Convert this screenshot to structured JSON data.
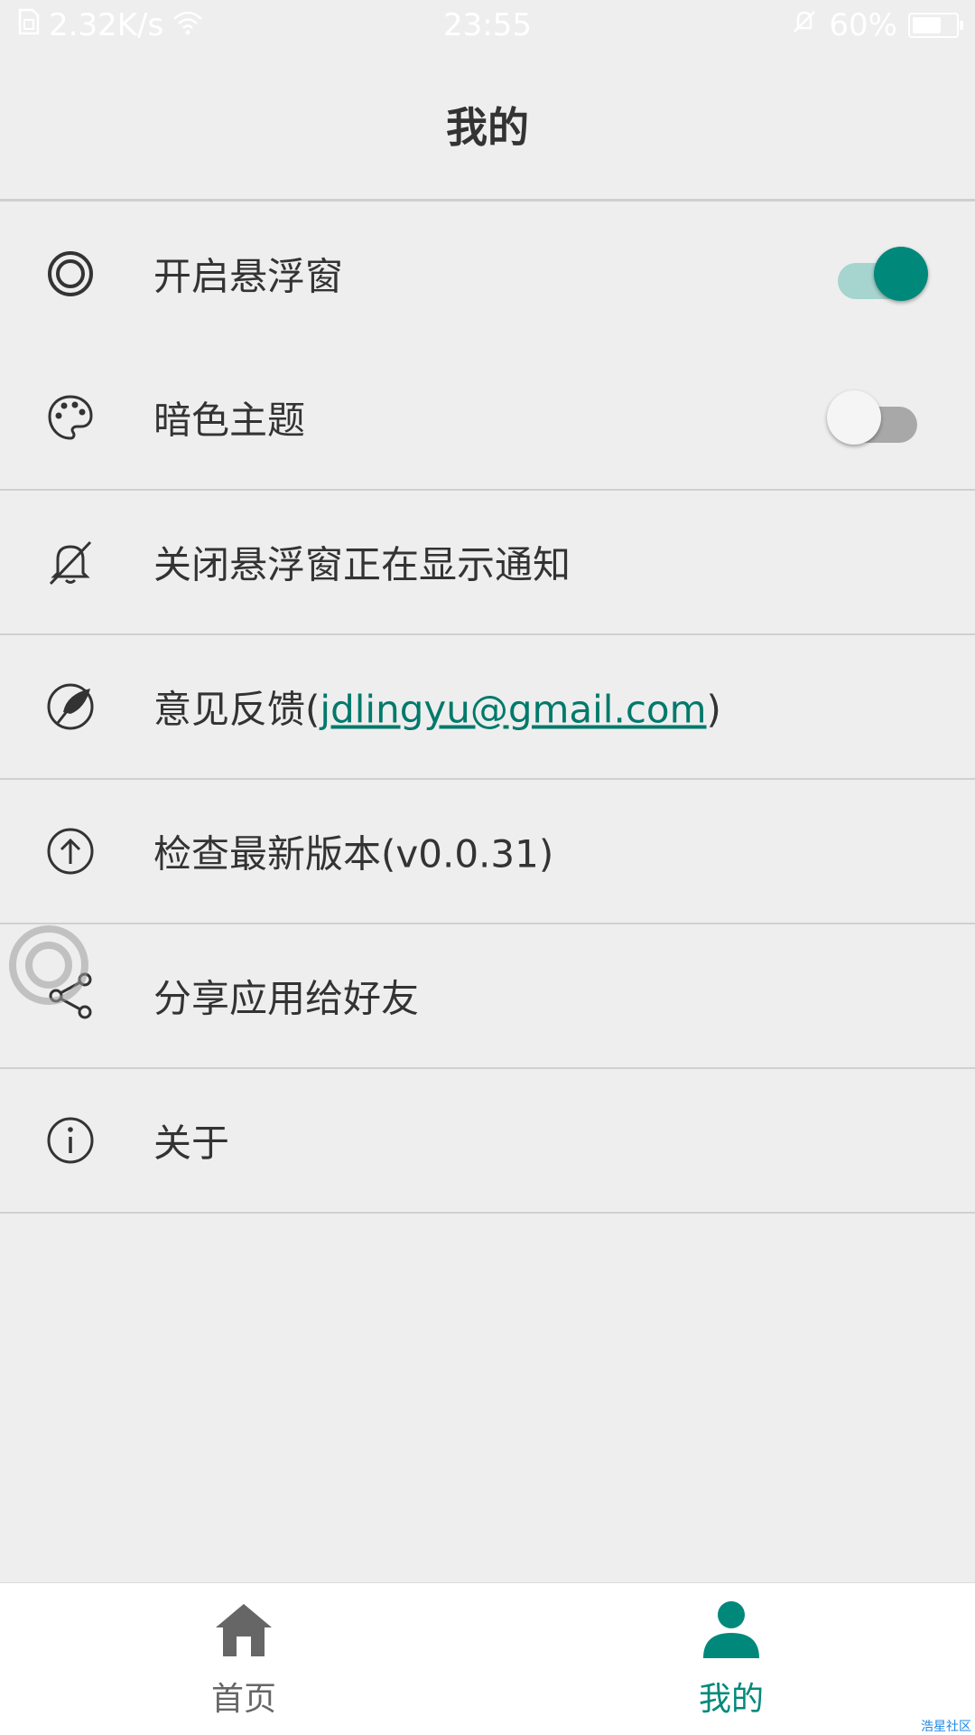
{
  "status_bar": {
    "network_speed": "2.32K/s",
    "time": "23:55",
    "battery": "60%"
  },
  "header": {
    "title": "我的"
  },
  "settings": {
    "floating_window": {
      "label": "开启悬浮窗",
      "icon": "target-icon",
      "enabled": true
    },
    "dark_theme": {
      "label": "暗色主题",
      "icon": "palette-icon",
      "enabled": false
    },
    "close_notification": {
      "label": "关闭悬浮窗正在显示通知",
      "icon": "bell-off-icon"
    },
    "feedback": {
      "label": "意见反馈",
      "paren_open": "(",
      "email": "jdlingyu@gmail.com",
      "paren_close": ")",
      "icon": "feather-icon"
    },
    "check_update": {
      "label": "检查最新版本(v0.0.31)",
      "icon": "arrow-up-circle-icon"
    },
    "share": {
      "label": "分享应用给好友",
      "icon": "share-icon"
    },
    "about": {
      "label": "关于",
      "icon": "info-icon"
    }
  },
  "bottom_nav": {
    "home": {
      "label": "首页",
      "icon": "home-icon"
    },
    "mine": {
      "label": "我的",
      "icon": "person-icon"
    }
  },
  "watermark": "浩星社区",
  "colors": {
    "accent": "#00897b",
    "background": "#eeeeee",
    "text": "#333333"
  }
}
